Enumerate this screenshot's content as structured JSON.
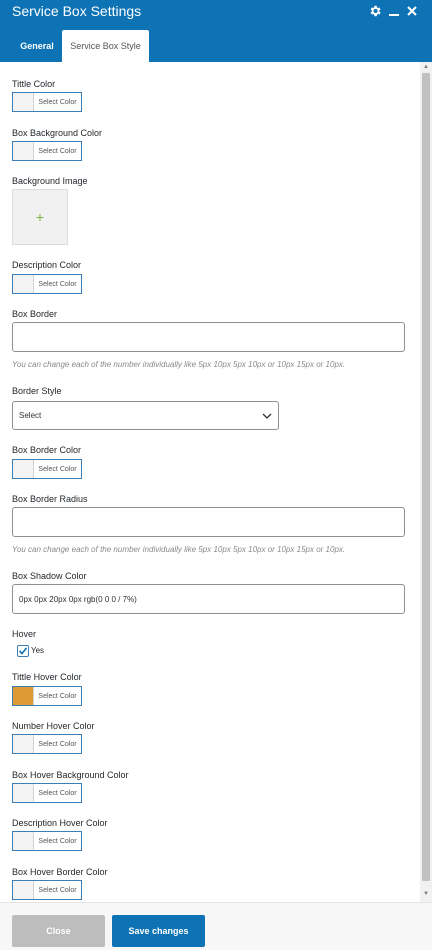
{
  "dialog": {
    "title": "Service Box Settings",
    "icons": [
      "gear-icon",
      "minimize-icon",
      "close-icon"
    ]
  },
  "tabs": [
    {
      "label": "General",
      "active": false
    },
    {
      "label": "Service Box Style",
      "active": true
    }
  ],
  "fields": {
    "tittle_color": {
      "label": "Tittle Color",
      "button": "Select Color"
    },
    "box_background_color": {
      "label": "Box Background Color",
      "button": "Select Color"
    },
    "background_image": {
      "label": "Background Image",
      "add_symbol": "+"
    },
    "description_color": {
      "label": "Description Color",
      "button": "Select Color"
    },
    "box_border": {
      "label": "Box Border",
      "value": "",
      "help": "You can change each of the number individually like 5px 10px 5px 10px or 10px 15px or 10px."
    },
    "border_style": {
      "label": "Border Style",
      "selected": "Select"
    },
    "box_border_color": {
      "label": "Box Border Color",
      "button": "Select Color"
    },
    "box_border_radius": {
      "label": "Box Border Radius",
      "value": "",
      "help": "You can change each of the number individually like 5px 10px 5px 10px or 10px 15px or 10px."
    },
    "box_shadow_color": {
      "label": "Box Shadow Color",
      "value": "0px 0px 20px 0px rgb(0 0 0 / 7%)"
    },
    "hover": {
      "label": "Hover",
      "checkbox_label": "Yes",
      "checked": true
    },
    "tittle_hover_color": {
      "label": "Tittle Hover Color",
      "button": "Select Color",
      "color": "#dd9933"
    },
    "number_hover_color": {
      "label": "Number Hover Color",
      "button": "Select Color"
    },
    "box_hover_background_color": {
      "label": "Box Hover Background Color",
      "button": "Select Color"
    },
    "description_hover_color": {
      "label": "Description Hover Color",
      "button": "Select Color"
    },
    "box_hover_border_color": {
      "label": "Box Hover Border Color",
      "button": "Select Color"
    }
  },
  "footer": {
    "close_label": "Close",
    "save_label": "Save changes"
  },
  "colors": {
    "brand": "#0e73b4",
    "close_button": "#bdbdbd"
  }
}
